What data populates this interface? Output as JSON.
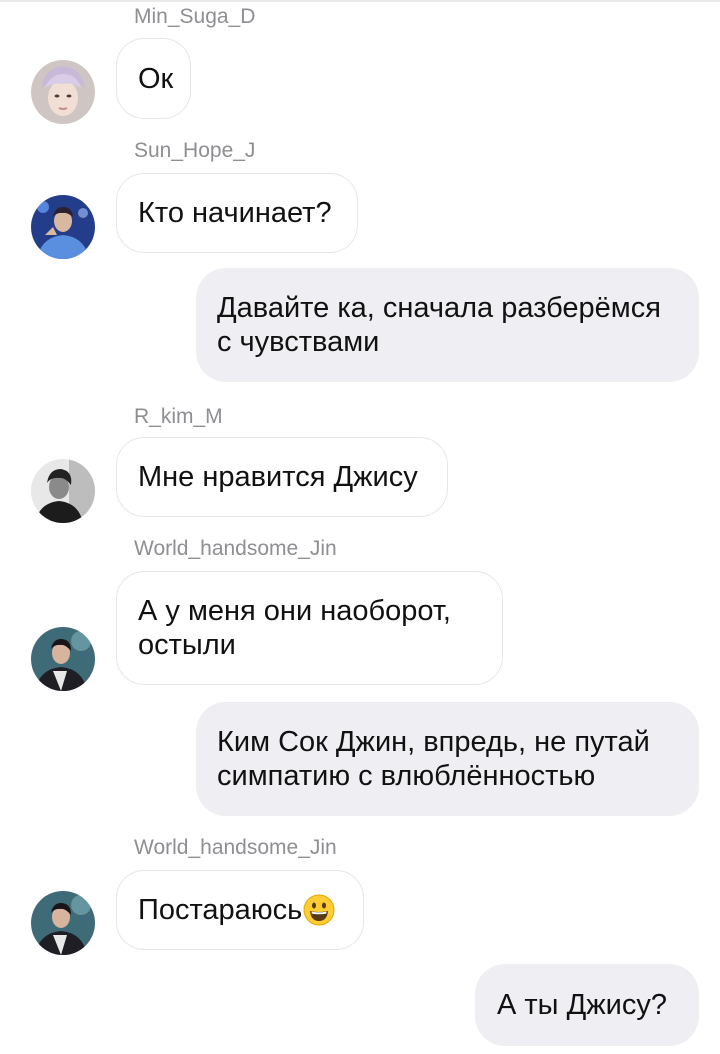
{
  "messages": [
    {
      "type": "incoming",
      "sender": "Min_Suga_D",
      "text": "Ок",
      "avatar": "min-suga-avatar"
    },
    {
      "type": "incoming",
      "sender": "Sun_Hope_J",
      "text": "Кто начинает?",
      "avatar": "sun-hope-avatar"
    },
    {
      "type": "outgoing",
      "lines": [
        "Давайте ка, сначала разберёмся",
        "с чувствами"
      ]
    },
    {
      "type": "incoming",
      "sender": "R_kim_M",
      "text": "Мне нравится Джису",
      "avatar": "r-kim-avatar"
    },
    {
      "type": "incoming",
      "sender": "World_handsome_Jin",
      "lines": [
        "А у меня они наоборот,",
        "остыли"
      ],
      "avatar": "world-handsome-jin-avatar"
    },
    {
      "type": "outgoing",
      "lines": [
        "Ким Сок Джин, впредь, не путай",
        "симпатию с влюблённостью"
      ]
    },
    {
      "type": "incoming",
      "sender": "World_handsome_Jin",
      "text": "Постараюсь",
      "emoji": "grinning-face-emoji",
      "avatar": "world-handsome-jin-avatar"
    },
    {
      "type": "outgoing",
      "text": "А ты Джису?"
    }
  ],
  "colors": {
    "background": "#ffffff",
    "incoming_bubble": "#ffffff",
    "incoming_border": "#e6e6ea",
    "outgoing_bubble": "#efeff3",
    "sender_name": "#8e8e93",
    "text": "#111111"
  }
}
